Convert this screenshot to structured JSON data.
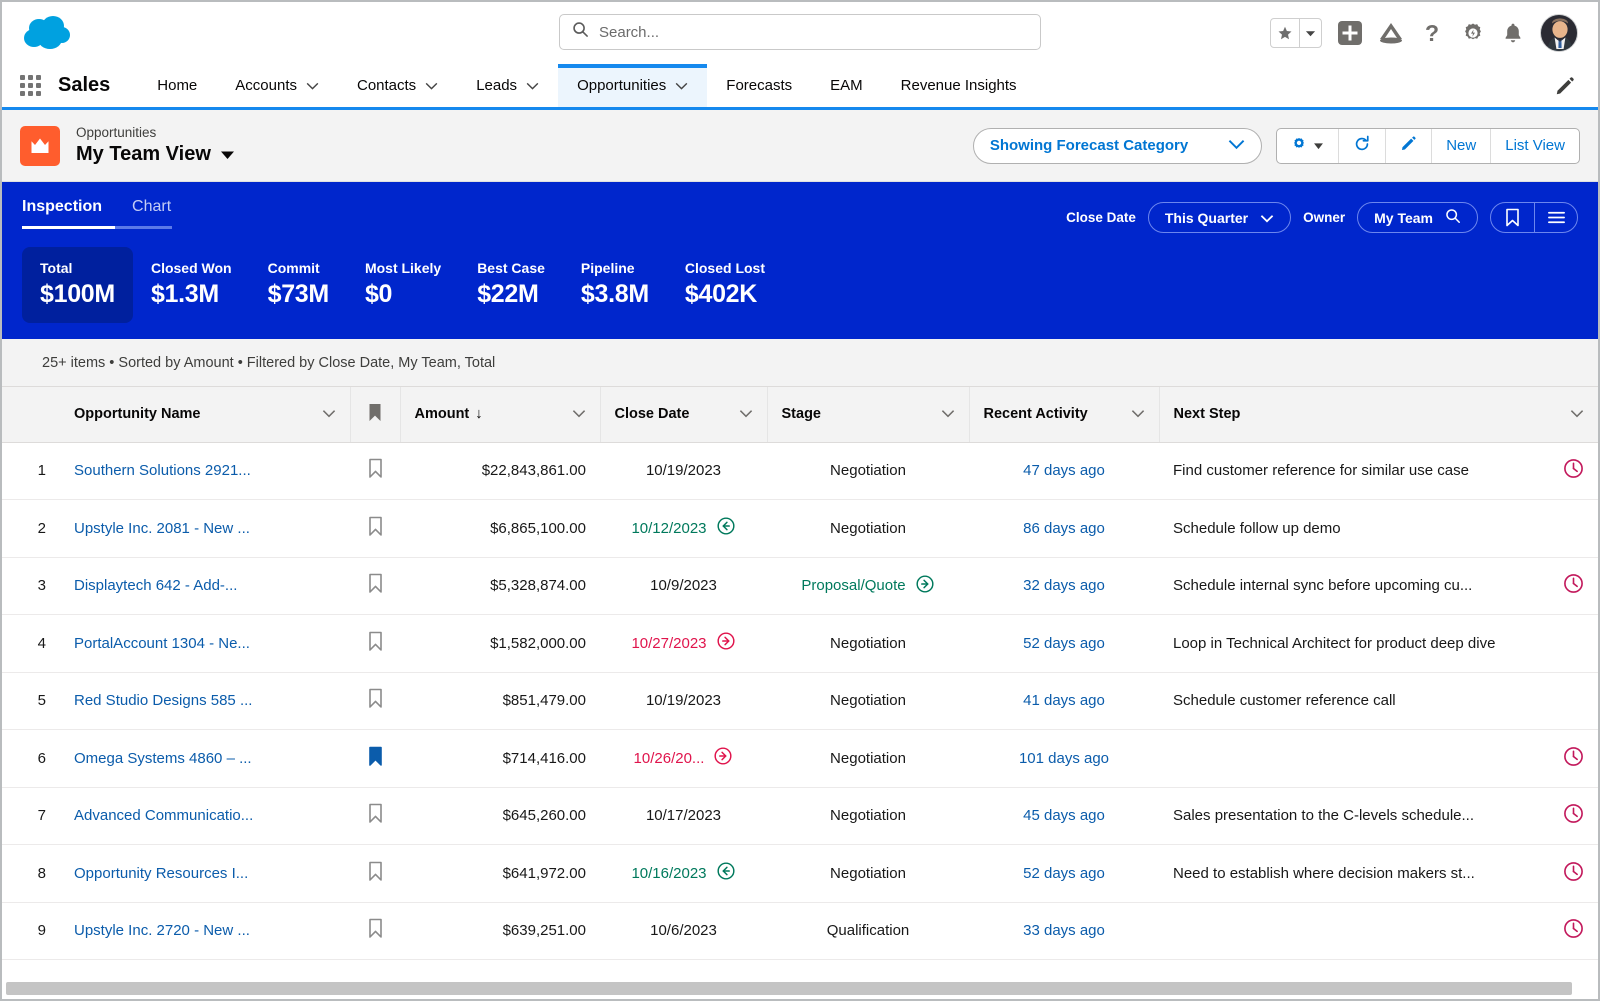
{
  "global_header": {
    "logo_name": "salesforce-cloud-logo",
    "search": {
      "placeholder": "Search...",
      "value": ""
    },
    "icons": [
      {
        "name": "favorites-star-icon",
        "glyph": "★"
      },
      {
        "name": "favorites-dropdown-icon",
        "glyph": "▾"
      },
      {
        "name": "add-plus-icon",
        "glyph": "+"
      },
      {
        "name": "setup-assistant-icon",
        "glyph": "▲"
      },
      {
        "name": "help-question-icon",
        "glyph": "?"
      },
      {
        "name": "setup-gear-icon",
        "glyph": "⚙"
      },
      {
        "name": "notifications-bell-icon",
        "glyph": "🔔"
      }
    ]
  },
  "app_nav": {
    "app_name": "Sales",
    "tabs": [
      {
        "label": "Home",
        "has_caret": false,
        "active": false
      },
      {
        "label": "Accounts",
        "has_caret": true,
        "active": false
      },
      {
        "label": "Contacts",
        "has_caret": true,
        "active": false
      },
      {
        "label": "Leads",
        "has_caret": true,
        "active": false
      },
      {
        "label": "Opportunities",
        "has_caret": true,
        "active": true
      },
      {
        "label": "Forecasts",
        "has_caret": false,
        "active": false
      },
      {
        "label": "EAM",
        "has_caret": false,
        "active": false
      },
      {
        "label": "Revenue Insights",
        "has_caret": false,
        "active": false
      }
    ],
    "edit_icon": "pencil-icon"
  },
  "page_header": {
    "entity_icon": "opportunity-crown-icon",
    "entity_icon_color": "#ff5d2d",
    "eyebrow": "Opportunities",
    "title": "My Team View",
    "title_caret": "▼",
    "forecast_select": {
      "label": "Showing Forecast Category",
      "caret": "⌄"
    },
    "actions": [
      {
        "label": "",
        "name": "list-settings-gear-button",
        "icon": "gear-icon"
      },
      {
        "label": "",
        "name": "refresh-button",
        "icon": "refresh-icon"
      },
      {
        "label": "",
        "name": "edit-button",
        "icon": "pencil-icon"
      },
      {
        "label": "New",
        "name": "new-button",
        "icon": null
      },
      {
        "label": "List View",
        "name": "list-view-button",
        "icon": null
      }
    ]
  },
  "inspection_bar": {
    "background": "#0026cc",
    "tabs": [
      {
        "label": "Inspection",
        "active": true
      },
      {
        "label": "Chart",
        "active": false
      }
    ],
    "filters": {
      "close_date_label": "Close Date",
      "close_date_value": "This Quarter",
      "owner_label": "Owner",
      "owner_value": "My Team",
      "owner_icon": "search-icon",
      "bookmark_icon": "bookmark-icon",
      "list-icon": "hamburger-list-icon"
    },
    "metrics": [
      {
        "label": "Total",
        "value": "$100M",
        "selected": true
      },
      {
        "label": "Closed Won",
        "value": "$1.3M",
        "selected": false
      },
      {
        "label": "Commit",
        "value": "$73M",
        "selected": false
      },
      {
        "label": "Most Likely",
        "value": "$0",
        "selected": false
      },
      {
        "label": "Best Case",
        "value": "$22M",
        "selected": false
      },
      {
        "label": "Pipeline",
        "value": "$3.8M",
        "selected": false
      },
      {
        "label": "Closed Lost",
        "value": "$402K",
        "selected": false
      }
    ]
  },
  "list_meta": "25+ items • Sorted by Amount • Filtered by Close Date, My Team, Total",
  "table": {
    "columns": [
      {
        "label": "",
        "key": "num",
        "caret": false
      },
      {
        "label": "Opportunity Name",
        "key": "name",
        "caret": true
      },
      {
        "label": "",
        "key": "bookmark",
        "caret": false,
        "icon": "bookmark-icon"
      },
      {
        "label": "Amount",
        "key": "amount",
        "caret": true,
        "sort": "↓"
      },
      {
        "label": "Close Date",
        "key": "close_date",
        "caret": true
      },
      {
        "label": "Stage",
        "key": "stage",
        "caret": true
      },
      {
        "label": "Recent Activity",
        "key": "recent_activity",
        "caret": true
      },
      {
        "label": "Next Step",
        "key": "next_step",
        "caret": true
      }
    ],
    "rows": [
      {
        "num": "1",
        "name": "Southern Solutions 2921...",
        "bookmarked": false,
        "amount": "$22,843,861.00",
        "close_date": "10/19/2023",
        "close_date_state": "normal",
        "close_date_icon": null,
        "stage": "Negotiation",
        "stage_state": "normal",
        "stage_icon": null,
        "recent_activity": "47 days ago",
        "next_step": "Find customer reference for similar use case",
        "has_clock": true
      },
      {
        "num": "2",
        "name": "Upstyle Inc. 2081 - New ...",
        "bookmarked": false,
        "amount": "$6,865,100.00",
        "close_date": "10/12/2023",
        "close_date_state": "green",
        "close_date_icon": "arrow-left-circle-icon",
        "stage": "Negotiation",
        "stage_state": "normal",
        "stage_icon": null,
        "recent_activity": "86 days ago",
        "next_step": "Schedule follow up demo",
        "has_clock": false
      },
      {
        "num": "3",
        "name": "Displaytech 642 - Add-...",
        "bookmarked": false,
        "amount": "$5,328,874.00",
        "close_date": "10/9/2023",
        "close_date_state": "normal",
        "close_date_icon": null,
        "stage": "Proposal/Quote",
        "stage_state": "green",
        "stage_icon": "arrow-right-circle-icon",
        "recent_activity": "32 days ago",
        "next_step": "Schedule internal sync before upcoming cu...",
        "has_clock": true
      },
      {
        "num": "4",
        "name": "PortalAccount 1304 - Ne...",
        "bookmarked": false,
        "amount": "$1,582,000.00",
        "close_date": "10/27/2023",
        "close_date_state": "red",
        "close_date_icon": "arrow-right-circle-icon",
        "stage": "Negotiation",
        "stage_state": "normal",
        "stage_icon": null,
        "recent_activity": "52 days ago",
        "next_step": "Loop in Technical Architect for product deep dive",
        "has_clock": false
      },
      {
        "num": "5",
        "name": "Red Studio Designs 585 ...",
        "bookmarked": false,
        "amount": "$851,479.00",
        "close_date": "10/19/2023",
        "close_date_state": "normal",
        "close_date_icon": null,
        "stage": "Negotiation",
        "stage_state": "normal",
        "stage_icon": null,
        "recent_activity": "41 days ago",
        "next_step": "Schedule customer reference call",
        "has_clock": false
      },
      {
        "num": "6",
        "name": "Omega Systems 4860 – ...",
        "bookmarked": true,
        "amount": "$714,416.00",
        "close_date": "10/26/20...",
        "close_date_state": "red",
        "close_date_icon": "arrow-right-circle-icon",
        "stage": "Negotiation",
        "stage_state": "normal",
        "stage_icon": null,
        "recent_activity": "101 days ago",
        "next_step": "",
        "has_clock": true
      },
      {
        "num": "7",
        "name": "Advanced Communicatio...",
        "bookmarked": false,
        "amount": "$645,260.00",
        "close_date": "10/17/2023",
        "close_date_state": "normal",
        "close_date_icon": null,
        "stage": "Negotiation",
        "stage_state": "normal",
        "stage_icon": null,
        "recent_activity": "45 days ago",
        "next_step": "Sales presentation to the C-levels schedule...",
        "has_clock": true
      },
      {
        "num": "8",
        "name": "Opportunity Resources I...",
        "bookmarked": false,
        "amount": "$641,972.00",
        "close_date": "10/16/2023",
        "close_date_state": "green",
        "close_date_icon": "arrow-left-circle-icon",
        "stage": "Negotiation",
        "stage_state": "normal",
        "stage_icon": null,
        "recent_activity": "52 days ago",
        "next_step": "Need to establish where decision makers st...",
        "has_clock": true
      },
      {
        "num": "9",
        "name": "Upstyle Inc. 2720 - New ...",
        "bookmarked": false,
        "amount": "$639,251.00",
        "close_date": "10/6/2023",
        "close_date_state": "normal",
        "close_date_icon": null,
        "stage": "Qualification",
        "stage_state": "normal",
        "stage_icon": null,
        "recent_activity": "33 days ago",
        "next_step": "",
        "has_clock": true
      }
    ]
  },
  "colors": {
    "brand_blue": "#0176d3",
    "inspection_blue": "#0026cc",
    "metric_selected": "#00209e",
    "link_blue": "#0b5cab",
    "green": "#00795c",
    "red": "#e0144c",
    "orange": "#ff5d2d"
  }
}
